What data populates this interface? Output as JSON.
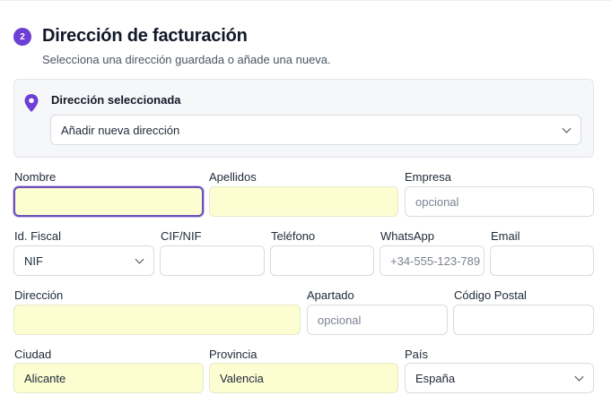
{
  "section": {
    "step_number": "2",
    "title": "Dirección de facturación",
    "subtitle": "Selecciona una dirección guardada o añade una nueva."
  },
  "address_picker": {
    "label": "Dirección seleccionada",
    "selected": "Añadir nueva dirección",
    "icon": "map-pin-icon"
  },
  "form": {
    "nombre": {
      "label": "Nombre",
      "value": ""
    },
    "apellidos": {
      "label": "Apellidos",
      "value": ""
    },
    "empresa": {
      "label": "Empresa",
      "placeholder": "opcional",
      "value": ""
    },
    "id_fiscal": {
      "label": "Id. Fiscal",
      "selected": "NIF"
    },
    "cif_nif": {
      "label": "CIF/NIF",
      "value": ""
    },
    "telefono": {
      "label": "Teléfono",
      "value": ""
    },
    "whatsapp": {
      "label": "WhatsApp",
      "placeholder": "+34-555-123-789",
      "value": ""
    },
    "email": {
      "label": "Email",
      "value": ""
    },
    "direccion": {
      "label": "Dirección",
      "value": ""
    },
    "apartado": {
      "label": "Apartado",
      "placeholder": "opcional",
      "value": ""
    },
    "codigo_postal": {
      "label": "Código Postal",
      "value": ""
    },
    "ciudad": {
      "label": "Ciudad",
      "value": "Alicante"
    },
    "provincia": {
      "label": "Provincia",
      "value": "Valencia"
    },
    "pais": {
      "label": "País",
      "selected": "España"
    }
  },
  "colors": {
    "accent": "#6d3fd6",
    "required_field_bg": "#fdfdd2",
    "focus_border": "#6b4fb8"
  }
}
